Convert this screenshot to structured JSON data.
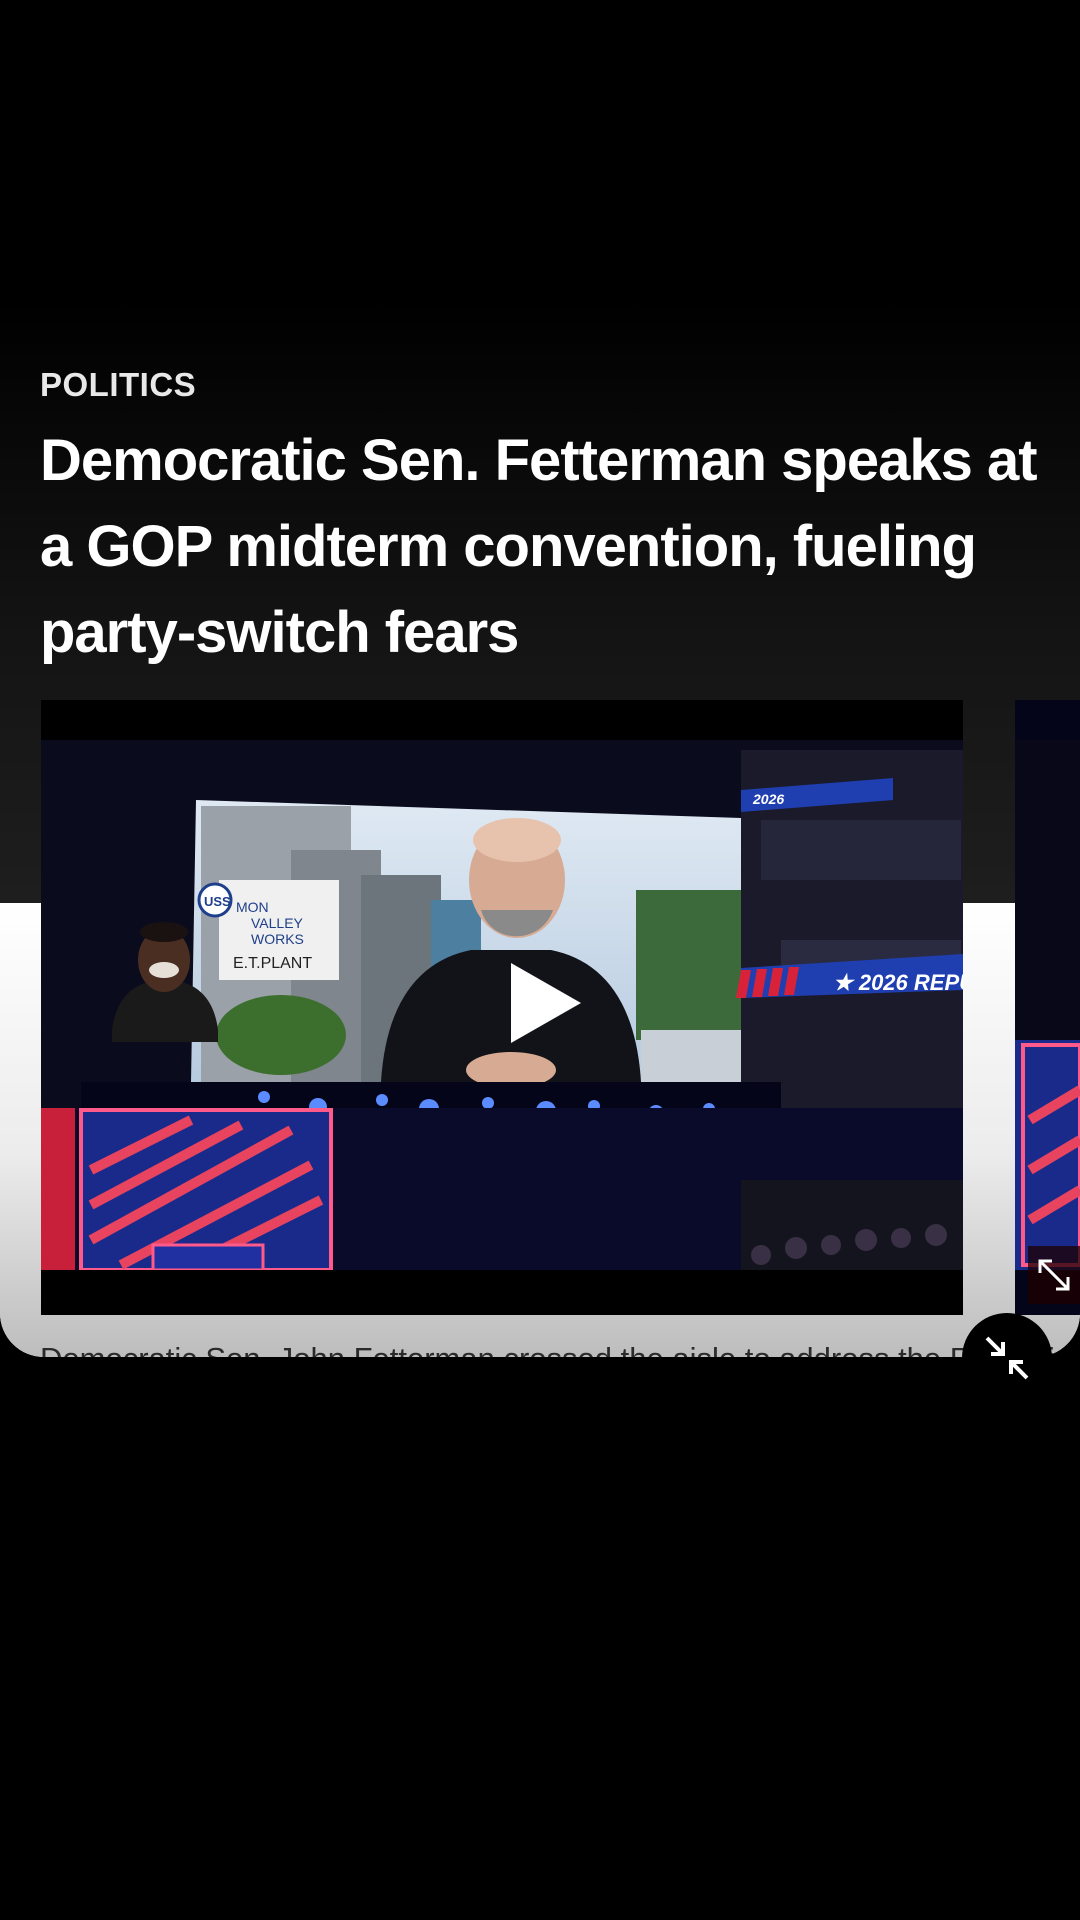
{
  "article": {
    "section": "POLITICS",
    "headline": "Democratic Sen. Fetterman speaks at a GOP midterm convention, fueling party-switch fears",
    "caption": "Democratic Sen. John Fetterman crossed the aisle to address the Republican... A vid"
  },
  "video": {
    "banner_text": "2026",
    "banner_text_right": "★ 2026 REPU",
    "sign_lines": [
      "MON",
      "VALLEY",
      "WORKS",
      "E.T.PLANT"
    ],
    "sign_logo": "USS"
  },
  "icons": {
    "play": "play-icon",
    "expand": "expand-icon",
    "collapse": "collapse-icon"
  },
  "colors": {
    "accent_red": "#d8223a",
    "accent_blue": "#1f3fb0",
    "stage_dark": "#0a0a2a"
  }
}
